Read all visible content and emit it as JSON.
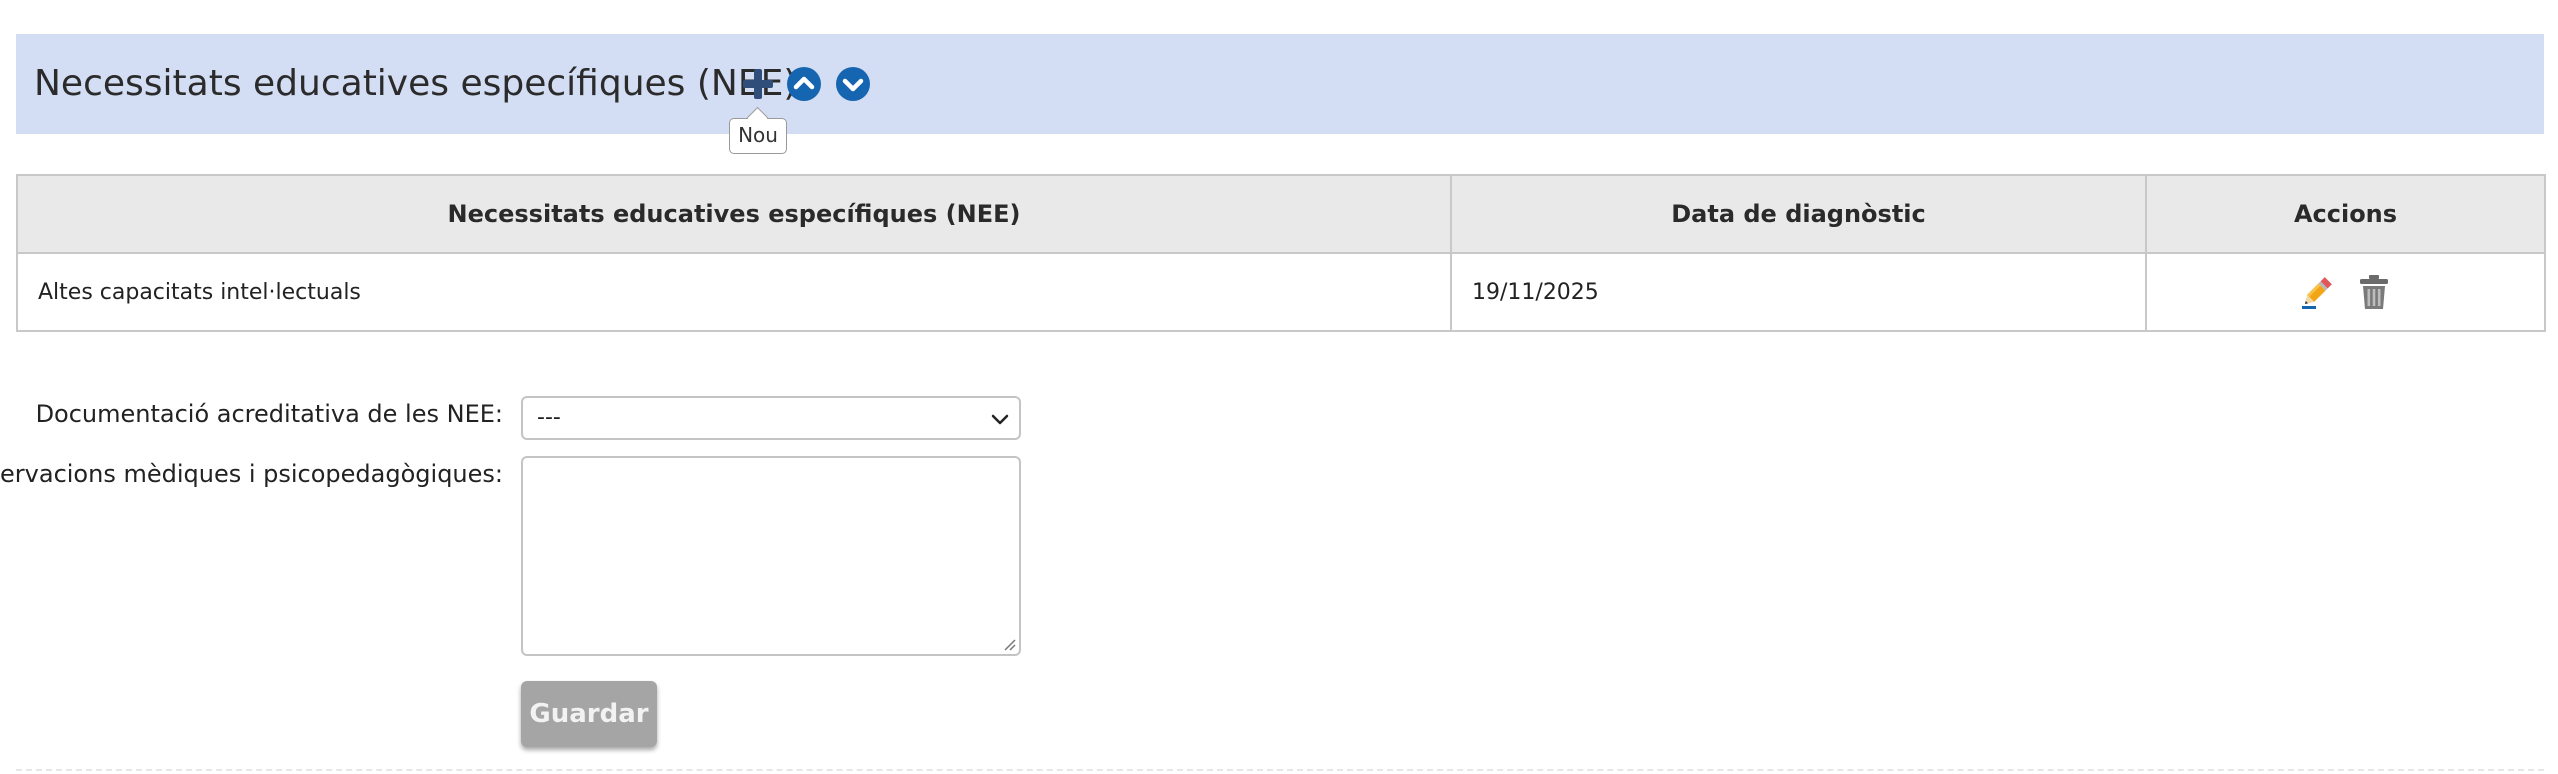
{
  "section": {
    "title": "Necessitats educatives específiques (NEE)",
    "add_tooltip": "Nou",
    "icons": {
      "add": "plus-icon",
      "up": "chevron-up-circle-icon",
      "down": "chevron-down-circle-icon"
    }
  },
  "table": {
    "headers": [
      "Necessitats educatives específiques (NEE)",
      "Data de diagnòstic",
      "Accions"
    ],
    "rows": [
      {
        "nee": "Altes capacitats intel·lectuals",
        "date": "19/11/2025",
        "actions": [
          "pencil-edit-icon",
          "trash-delete-icon"
        ]
      }
    ]
  },
  "form": {
    "documentation_label": "Documentació acreditativa de les NEE:",
    "documentation_value": "---",
    "observations_label": "Observacions mèdiques i psicopedagògiques:",
    "observations_value": "",
    "save_label": "Guardar"
  },
  "colors": {
    "header_bg": "#d3ddf3",
    "accent_blue": "#1565b0",
    "table_header_bg": "#e9e9e9",
    "disabled_button": "#a5a5a5"
  }
}
